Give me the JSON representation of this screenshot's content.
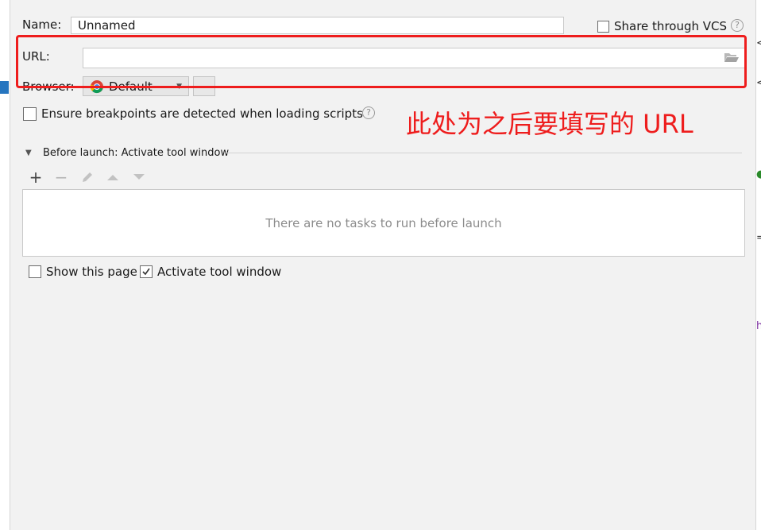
{
  "form": {
    "name_label": "Name:",
    "name_value": "Unnamed",
    "share_vcs_label": "Share through VCS",
    "share_vcs_checked": false,
    "url_label": "URL:",
    "url_value": "",
    "browser_label": "Browser:",
    "browser_value": "Default",
    "browse_button_label": "...",
    "ensure_breakpoints_label": "Ensure breakpoints are detected when loading scripts",
    "ensure_breakpoints_checked": false
  },
  "before_launch": {
    "title": "Before launch: Activate tool window",
    "toolbar": {
      "add": "+",
      "remove": "−"
    },
    "empty_text": "There are no tasks to run before launch"
  },
  "footer": {
    "show_page_label": "Show this page",
    "show_page_checked": false,
    "activate_tool_label": "Activate tool window",
    "activate_tool_checked": true
  },
  "annotation": {
    "text": "此处为之后要填写的 URL",
    "color": "#ee1d1d"
  },
  "colors": {
    "accent": "#2675bf",
    "background": "#f2f2f2"
  },
  "icons": {
    "folder": "folder-open-icon",
    "chrome": "chrome-icon",
    "help": "help-icon",
    "collapse": "triangle-down-icon",
    "edit": "pencil-icon",
    "up": "arrow-up-icon",
    "down": "arrow-down-icon"
  }
}
